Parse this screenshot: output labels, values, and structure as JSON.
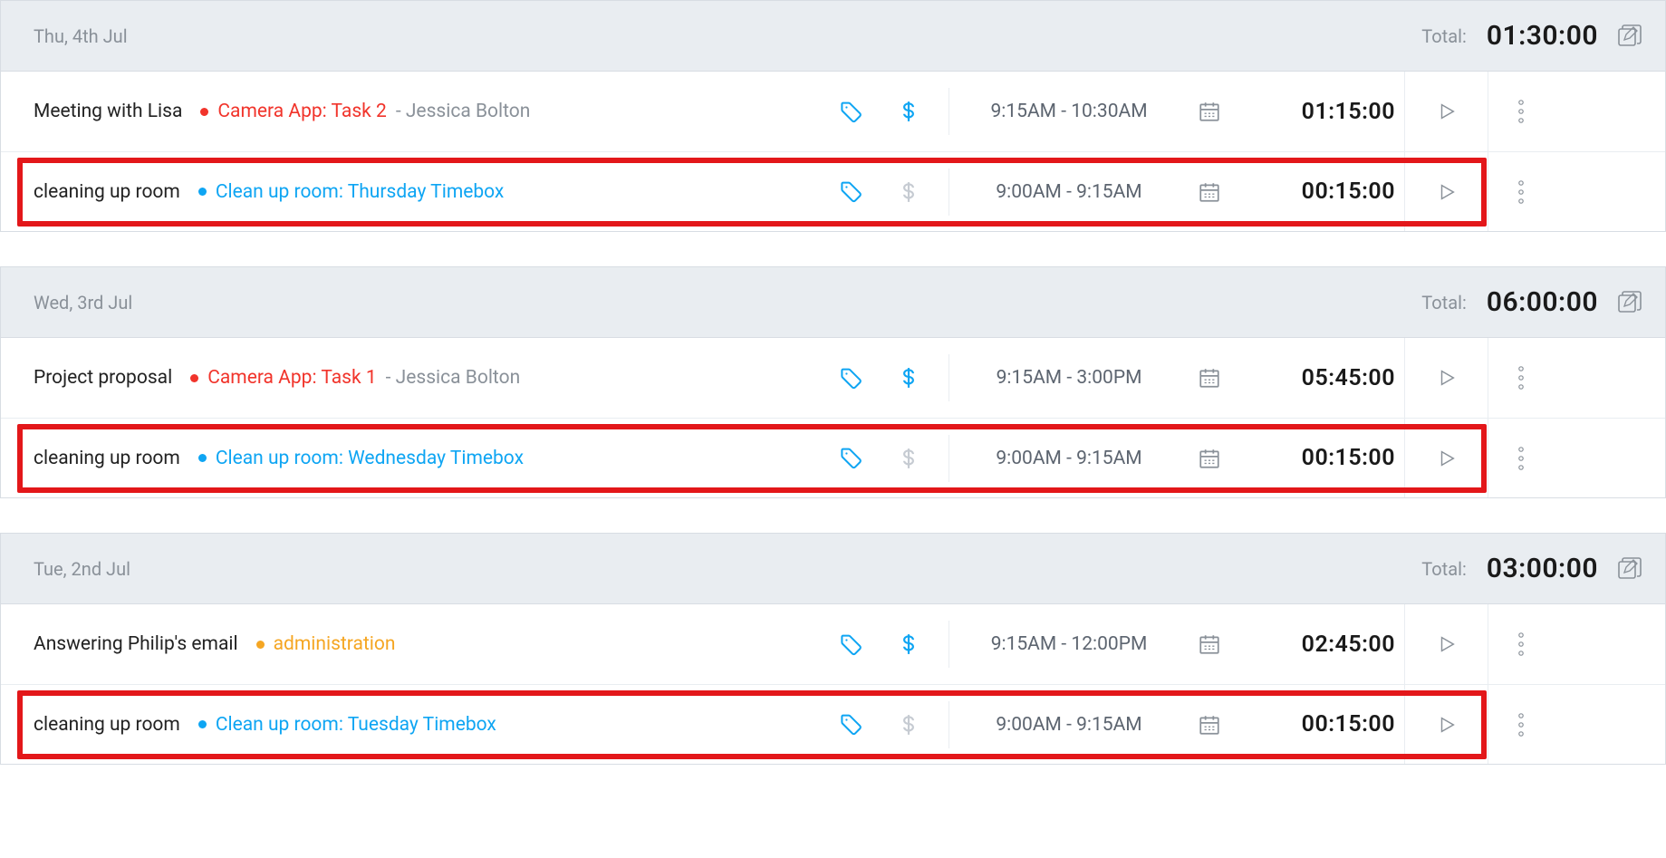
{
  "days": [
    {
      "date": "Thu, 4th Jul",
      "total_label": "Total:",
      "total": "01:30:00",
      "entries": [
        {
          "desc": "Meeting with Lisa",
          "project": "Camera App: Task 2",
          "client": "- Jessica Bolton",
          "proj_color": "red",
          "billable_active": true,
          "time_range": "9:15AM - 10:30AM",
          "duration": "01:15:00",
          "highlight": false
        },
        {
          "desc": "cleaning up room",
          "project": "Clean up room: Thursday Timebox",
          "client": "",
          "proj_color": "blue",
          "billable_active": false,
          "time_range": "9:00AM - 9:15AM",
          "duration": "00:15:00",
          "highlight": true
        }
      ]
    },
    {
      "date": "Wed, 3rd Jul",
      "total_label": "Total:",
      "total": "06:00:00",
      "entries": [
        {
          "desc": "Project proposal",
          "project": "Camera App: Task 1",
          "client": "- Jessica Bolton",
          "proj_color": "red",
          "billable_active": true,
          "time_range": "9:15AM - 3:00PM",
          "duration": "05:45:00",
          "highlight": false
        },
        {
          "desc": "cleaning up room",
          "project": "Clean up room: Wednesday Timebox",
          "client": "",
          "proj_color": "blue",
          "billable_active": false,
          "time_range": "9:00AM - 9:15AM",
          "duration": "00:15:00",
          "highlight": true
        }
      ]
    },
    {
      "date": "Tue, 2nd Jul",
      "total_label": "Total:",
      "total": "03:00:00",
      "entries": [
        {
          "desc": "Answering Philip's email",
          "project": "administration",
          "client": "",
          "proj_color": "yellow",
          "billable_active": true,
          "time_range": "9:15AM - 12:00PM",
          "duration": "02:45:00",
          "highlight": false
        },
        {
          "desc": "cleaning up room",
          "project": "Clean up room: Tuesday Timebox",
          "client": "",
          "proj_color": "blue",
          "billable_active": false,
          "time_range": "9:00AM - 9:15AM",
          "duration": "00:15:00",
          "highlight": true
        }
      ]
    }
  ]
}
